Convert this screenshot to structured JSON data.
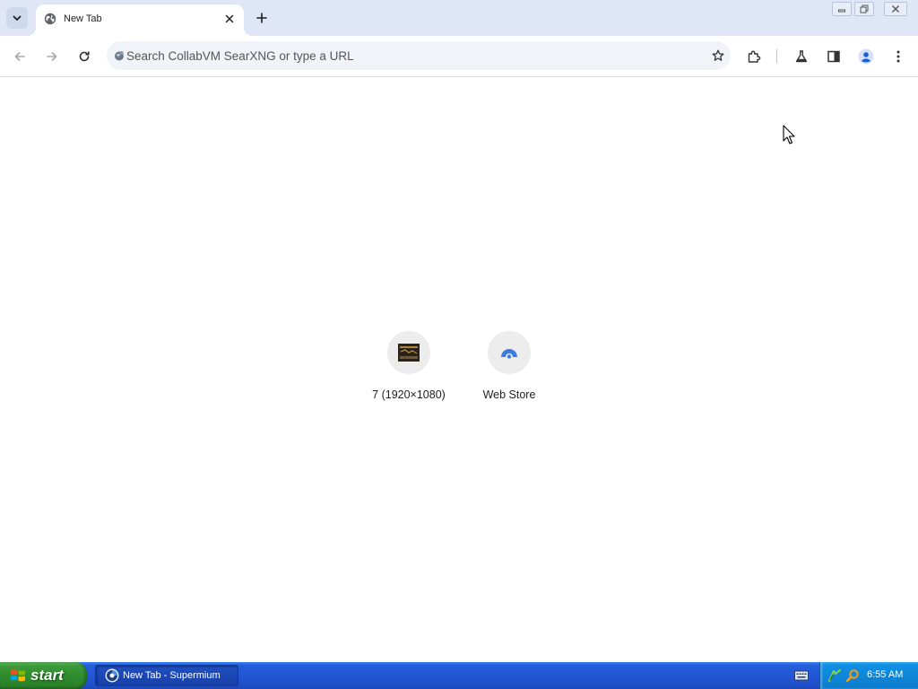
{
  "browser": {
    "tabs": [
      {
        "title": "New Tab",
        "active": true
      }
    ],
    "omnibox": {
      "placeholder": "Search CollabVM SearXNG or type a URL",
      "value": ""
    }
  },
  "new_tab_page": {
    "shortcuts": [
      {
        "label": "7 (1920×1080)",
        "icon": "thumbnail-icon"
      },
      {
        "label": "Web Store",
        "icon": "web-store-icon"
      }
    ]
  },
  "taskbar": {
    "start_label": "start",
    "items": [
      {
        "label": "New Tab - Supermium",
        "icon": "supermium-icon",
        "active": true
      }
    ],
    "clock": "6:55 AM"
  },
  "colors": {
    "tabstrip_bg": "#dfe7f6",
    "omnibox_bg": "#f0f3f8",
    "taskbar_blue": "#245edb",
    "start_green": "#3c9a3a",
    "tray_blue": "#0f86d8"
  }
}
